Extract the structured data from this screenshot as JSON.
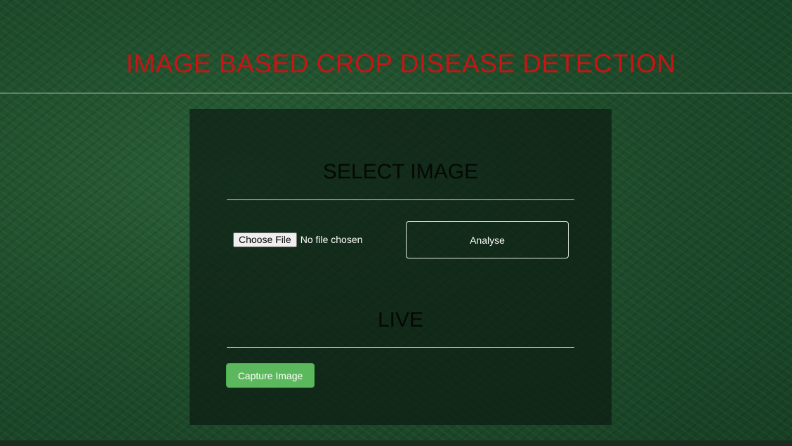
{
  "header": {
    "title": "IMAGE BASED CROP DISEASE DETECTION"
  },
  "select_section": {
    "title": "SELECT IMAGE",
    "choose_file_label": "Choose File",
    "file_status": "No file chosen",
    "analyse_label": "Analyse"
  },
  "live_section": {
    "title": "LIVE",
    "capture_label": "Capture Image"
  },
  "colors": {
    "title_red": "#c81414",
    "capture_green": "#5cb85c",
    "background_green": "#1d4a2a"
  }
}
